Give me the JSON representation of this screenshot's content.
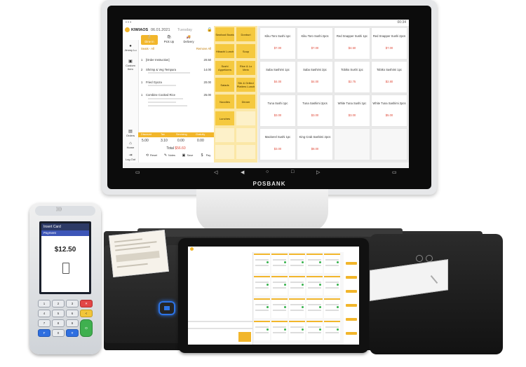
{
  "monitor": {
    "brand": "POSBANK",
    "time": "00:34",
    "app": {
      "logo_text": "KIWIAOS",
      "date": "06.01.2021",
      "day": "Tuesday"
    },
    "rail": [
      {
        "label": "Jimmy Lu"
      },
      {
        "label": "Custom Item"
      },
      {
        "label": "Orders"
      },
      {
        "label": "Home"
      },
      {
        "label": "Log Out"
      }
    ],
    "order_tabs": [
      "Dine In",
      "Pick Up",
      "Delivery"
    ],
    "order_header": {
      "left": "Seats - All",
      "right": "Remove All"
    },
    "order_items": [
      {
        "qty": "1",
        "name": "[Order Instruction]",
        "price": "20.50"
      },
      {
        "qty": "2",
        "name": "Shrimp & Veg Tempura",
        "price": "14.00"
      },
      {
        "qty": "1",
        "name": "Fried Gyoza",
        "price": "20.00"
      },
      {
        "qty": "1",
        "name": "Combine Cooked Rice",
        "price": "25.00"
      }
    ],
    "summary_labels": [
      "Discount",
      "Tax",
      "Servicing",
      "Gratuity"
    ],
    "summary_values": [
      "5.00",
      "3.10",
      "0.00",
      "0.00"
    ],
    "total_label": "Total",
    "total_value": "$56.60",
    "bottom_actions": [
      "Reset",
      "Notes",
      "Save",
      "Pay"
    ],
    "categories": [
      [
        "Seafood Boats",
        "Donburi"
      ],
      [
        "Hibachi Lunch",
        "Soup"
      ],
      [
        "Sushi Appetizers",
        "Rice & Lo Mein"
      ],
      [
        "Salads",
        "Stir & Grilled Platters Lunch"
      ],
      [
        "Noodles",
        "Dinner"
      ],
      [
        "Lunches",
        ""
      ]
    ],
    "items": [
      [
        {
          "name": "Kiku Toro Sushi 1pc",
          "price": "$7.00"
        },
        {
          "name": "Kiku Toro Sushi 2pcs",
          "price": "$7.00"
        },
        {
          "name": "Red Snapper Sushi 1pc",
          "price": "$4.50"
        },
        {
          "name": "Red Snapper Sushi 2pcs",
          "price": "$7.00"
        }
      ],
      [
        {
          "name": "Saba Sashimi 1pc",
          "price": "$4.00"
        },
        {
          "name": "Saba Sashimi 2pc",
          "price": "$4.00"
        },
        {
          "name": "Tobiko Sushi 1pc",
          "price": "$2.75"
        },
        {
          "name": "Tobiko Sashimi 1pc",
          "price": "$2.80"
        }
      ],
      [
        {
          "name": "Tuna Sushi 1pc",
          "price": "$3.00"
        },
        {
          "name": "Tuna Sashimi 2pcs",
          "price": "$3.00"
        },
        {
          "name": "White Tuna Sushi 1pc",
          "price": "$3.00"
        },
        {
          "name": "White Tuna Sashimi 2pcs",
          "price": "$5.00"
        }
      ],
      [
        {
          "name": "Mackerel Sushi 1pc",
          "price": "$3.00"
        },
        {
          "name": "King Crab Sashimi 2pcs",
          "price": "$8.00"
        },
        {
          "name": "",
          "price": ""
        },
        {
          "name": "",
          "price": ""
        }
      ]
    ]
  },
  "terminal": {
    "header": "Insert Card",
    "subheader": "Payment",
    "amount": "$12.50",
    "keys": [
      [
        "1",
        "2",
        "3",
        "✕"
      ],
      [
        "4",
        "5",
        "6",
        "<"
      ],
      [
        "7",
        "8",
        "9",
        ""
      ],
      [
        "F",
        "0",
        "#",
        "O"
      ]
    ]
  }
}
